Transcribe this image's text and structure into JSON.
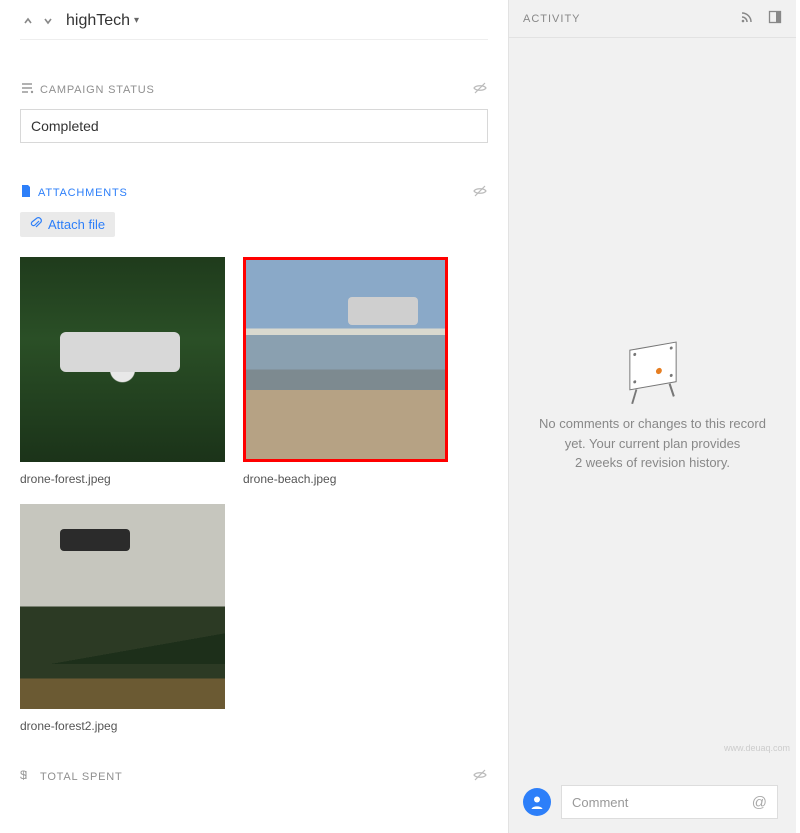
{
  "header": {
    "title": "highTech"
  },
  "sections": {
    "campaign_status": {
      "label": "CAMPAIGN STATUS",
      "value": "Completed"
    },
    "attachments": {
      "label": "ATTACHMENTS",
      "attach_button": "Attach file",
      "items": [
        {
          "filename": "drone-forest.jpeg",
          "selected": false
        },
        {
          "filename": "drone-beach.jpeg",
          "selected": true
        },
        {
          "filename": "drone-forest2.jpeg",
          "selected": false
        }
      ]
    },
    "total_spent": {
      "label": "TOTAL SPENT"
    }
  },
  "activity": {
    "label": "ACTIVITY",
    "empty_line1": "No comments or changes to this record",
    "empty_line2": "yet. Your current plan provides",
    "empty_line3": "2 weeks of revision history.",
    "comment_placeholder": "Comment"
  },
  "watermark": "www.deuaq.com"
}
